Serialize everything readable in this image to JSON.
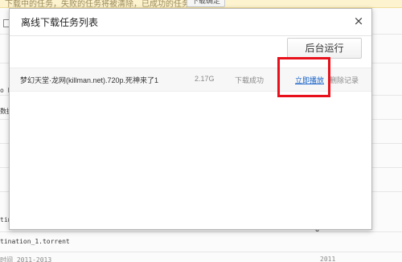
{
  "background": {
    "notice_text": "下载中的任务，失败的任务将被清除，已成功的任务保留",
    "notice_button": "下载确定",
    "frag_1": "o E",
    "frag_2": "数据",
    "frag_3": "tin",
    "frag_4": "tination_1.torrent",
    "frag_5": "G",
    "frag_6": "时间 2011-2013",
    "frag_7": "2011"
  },
  "dialog": {
    "title": "离线下载任务列表",
    "close_glyph": "×",
    "run_background_label": "后台运行",
    "tasks": [
      {
        "name": "梦幻天堂·龙网(killman.net).720p.死神来了1",
        "size": "2.17G",
        "status": "下载成功",
        "play_label": "立即播放",
        "delete_label": "删除记录"
      }
    ]
  },
  "colors": {
    "link": "#1a64c8",
    "highlight": "#e8101a"
  }
}
